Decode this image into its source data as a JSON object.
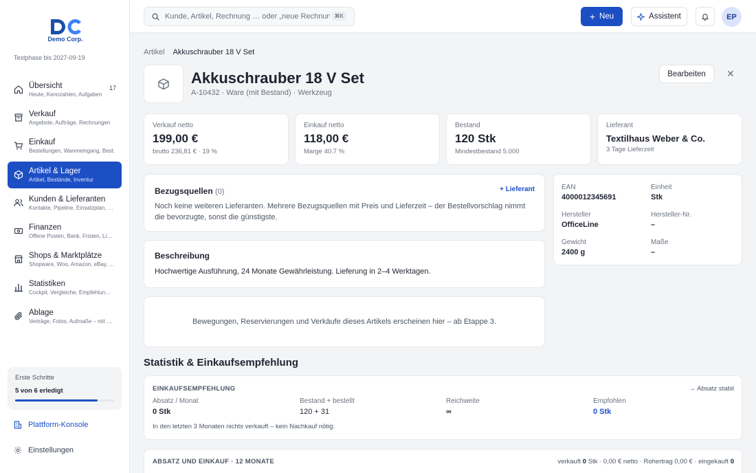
{
  "brand": {
    "name": "Demo Corp.",
    "accent": "#1d4fc4"
  },
  "sidebar": {
    "trial": "Testphase bis 2027-09-19",
    "items": [
      {
        "label": "Übersicht",
        "sub": "Heute, Kennzahlen, Aufgaben",
        "icon": "home-icon",
        "badge": "17"
      },
      {
        "label": "Verkauf",
        "sub": "Angebote, Aufträge, Rechnungen",
        "icon": "archive-icon"
      },
      {
        "label": "Einkauf",
        "sub": "Bestellungen, Wareneingang, Best.",
        "icon": "cart-icon"
      },
      {
        "label": "Artikel & Lager",
        "sub": "Artikel, Bestände, Inventur",
        "icon": "box-icon",
        "active": true
      },
      {
        "label": "Kunden & Lieferanten",
        "sub": "Kontakte, Pipeline, Einsatzplan, …",
        "icon": "users-icon"
      },
      {
        "label": "Finanzen",
        "sub": "Offene Posten, Bank, Fristen, Li…",
        "icon": "cash-icon"
      },
      {
        "label": "Shops & Marktplätze",
        "sub": "Shopware, Woo, Amazon, eBay, …",
        "icon": "store-icon"
      },
      {
        "label": "Statistiken",
        "sub": "Cockpit, Vergleiche, Empfehlun…",
        "icon": "bar-chart-icon"
      },
      {
        "label": "Ablage",
        "sub": "Verträge, Fotos, Aufmaße – mit …",
        "icon": "paperclip-icon"
      }
    ],
    "steps": {
      "title": "Erste Schritte",
      "progress_label": "5 von 6 erledigt",
      "progress": 0.833
    },
    "platform_label": "Plattform-Konsole",
    "settings_label": "Einstellungen"
  },
  "topbar": {
    "search_placeholder": "Kunde, Artikel, Rechnung … oder „neue Rechnung…",
    "shortcut": "⌘K",
    "new_label": "Neu",
    "assistant_label": "Assistent",
    "avatar_initials": "EP"
  },
  "breadcrumb": {
    "parent": "Artikel",
    "current": "Akkuschrauber 18 V Set"
  },
  "article": {
    "title": "Akkuschrauber 18 V Set",
    "subtitle": "A-10432 · Ware (mit Bestand) · Werkzeug",
    "edit_label": "Bearbeiten"
  },
  "kpis": [
    {
      "label": "Verkauf netto",
      "value": "199,00 €",
      "sub": "brutto 236,81 € · 19 %"
    },
    {
      "label": "Einkauf netto",
      "value": "118,00 €",
      "sub": "Marge 40.7 %"
    },
    {
      "label": "Bestand",
      "value": "120 Stk",
      "sub": "Mindestbestand 5.000"
    },
    {
      "label": "Lieferant",
      "value": "Textilhaus Weber & Co.",
      "sub": "3 Tage Lieferzeit"
    }
  ],
  "sources": {
    "title": "Bezugsquellen",
    "count": "(0)",
    "add_label": "+ Lieferant",
    "body": "Noch keine weiteren Lieferanten. Mehrere Bezugsquellen mit Preis und Lieferzeit – der Bestellvorschlag nimmt die bevorzugte, sonst die günstigste."
  },
  "description": {
    "title": "Beschreibung",
    "body": "Hochwertige Ausführung, 24 Monate Gewährleistung. Lieferung in 2–4 Werktagen."
  },
  "movements_note": "Bewegungen, Reservierungen und Verkäufe dieses Artikels erscheinen hier – ab Etappe 3.",
  "attributes": [
    {
      "label": "EAN",
      "value": "4000012345691"
    },
    {
      "label": "Einheit",
      "value": "Stk"
    },
    {
      "label": "Hersteller",
      "value": "OfficeLine"
    },
    {
      "label": "Hersteller-Nr.",
      "value": "–"
    },
    {
      "label": "Gewicht",
      "value": "2400 g"
    },
    {
      "label": "Maße",
      "value": "–"
    }
  ],
  "stats": {
    "heading": "Statistik & Einkaufsempfehlung",
    "reco": {
      "caption": "EINKAUFSEMPFEHLUNG",
      "trend": "→ Absatz stabil",
      "cols": [
        {
          "label": "Absatz / Monat",
          "value": "0 Stk"
        },
        {
          "label": "Bestand + bestellt",
          "value": "120 + 31"
        },
        {
          "label": "Reichweite",
          "value": "∞"
        },
        {
          "label": "Empfohlen",
          "value": "0 Stk"
        }
      ],
      "note": "In den letzten 3 Monaten nichts verkauft – kein Nachkauf nötig."
    },
    "sales": {
      "caption": "ABSATZ UND EINKAUF · 12 MONATE",
      "summary_prefix": "verkauft",
      "sold": "0",
      "summary_mid": "Stk · 0,00 € netto · Rohertrag 0,00 € · eingekauft",
      "bought": "0"
    }
  }
}
